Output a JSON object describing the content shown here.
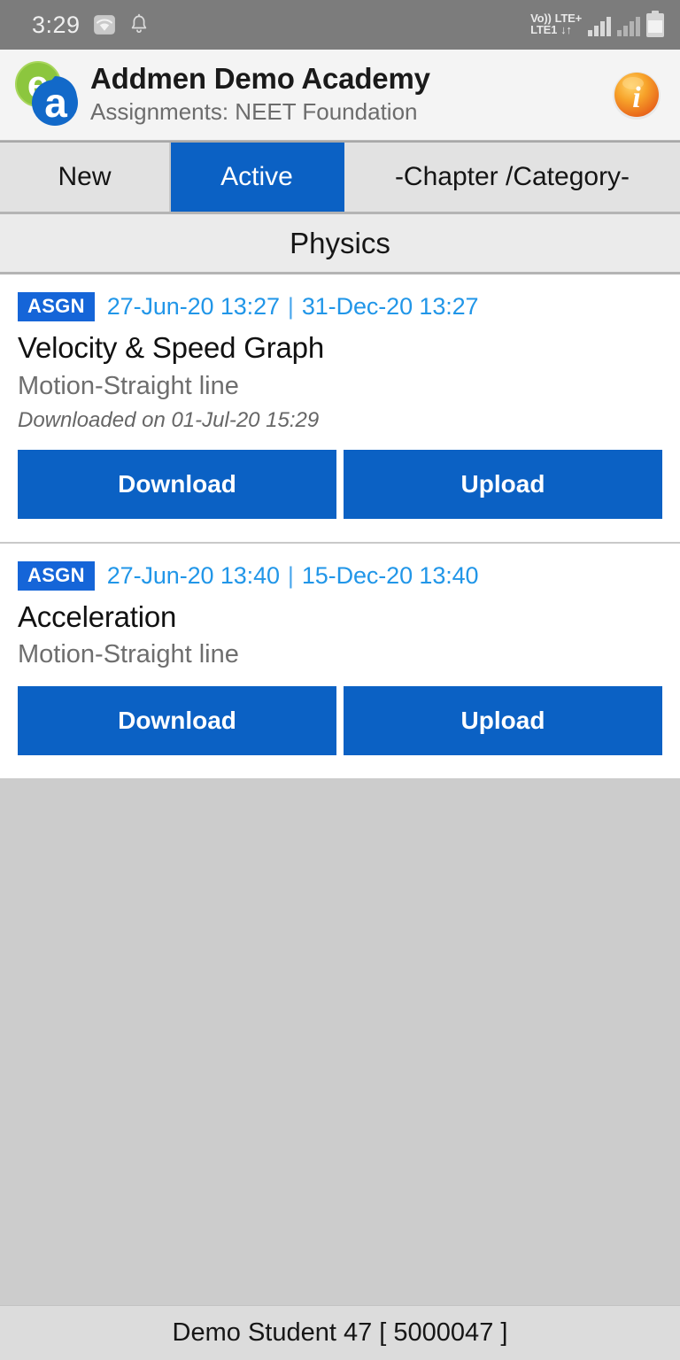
{
  "status_bar": {
    "clock": "3:29",
    "icons": [
      "wifi-icon",
      "notification-bell-icon"
    ],
    "network_line1": "Vo))",
    "network_line2": "LTE1",
    "network_label": "LTE+",
    "network_arrows": "↓↑"
  },
  "header": {
    "logo_letters": {
      "top": "e",
      "bottom": "a"
    },
    "title": "Addmen Demo Academy",
    "subtitle": "Assignments: NEET Foundation",
    "info_glyph": "i"
  },
  "tabs": [
    {
      "label": "New",
      "selected": false
    },
    {
      "label": "Active",
      "selected": true
    },
    {
      "label": "-Chapter /Category-",
      "selected": false
    }
  ],
  "section": {
    "title": "Physics"
  },
  "assignments": [
    {
      "badge": "ASGN",
      "start_date": "27-Jun-20 13:27",
      "separator": "|",
      "end_date": "31-Dec-20 13:27",
      "title": "Velocity & Speed Graph",
      "chapter": "Motion-Straight line",
      "note": "Downloaded on 01-Jul-20 15:29",
      "download_label": "Download",
      "upload_label": "Upload"
    },
    {
      "badge": "ASGN",
      "start_date": "27-Jun-20 13:40",
      "separator": "|",
      "end_date": "15-Dec-20 13:40",
      "title": "Acceleration",
      "chapter": "Motion-Straight line",
      "note": "",
      "download_label": "Download",
      "upload_label": "Upload"
    }
  ],
  "footer": {
    "user": "Demo Student 47 [ 5000047 ]"
  },
  "colors": {
    "accent_blue": "#0b61c4",
    "badge_blue": "#1565d8",
    "date_blue": "#2196e8",
    "status_bar_gray": "#7c7c7c",
    "body_gray": "#cccccc",
    "footer_gray": "#dcdcdc"
  }
}
